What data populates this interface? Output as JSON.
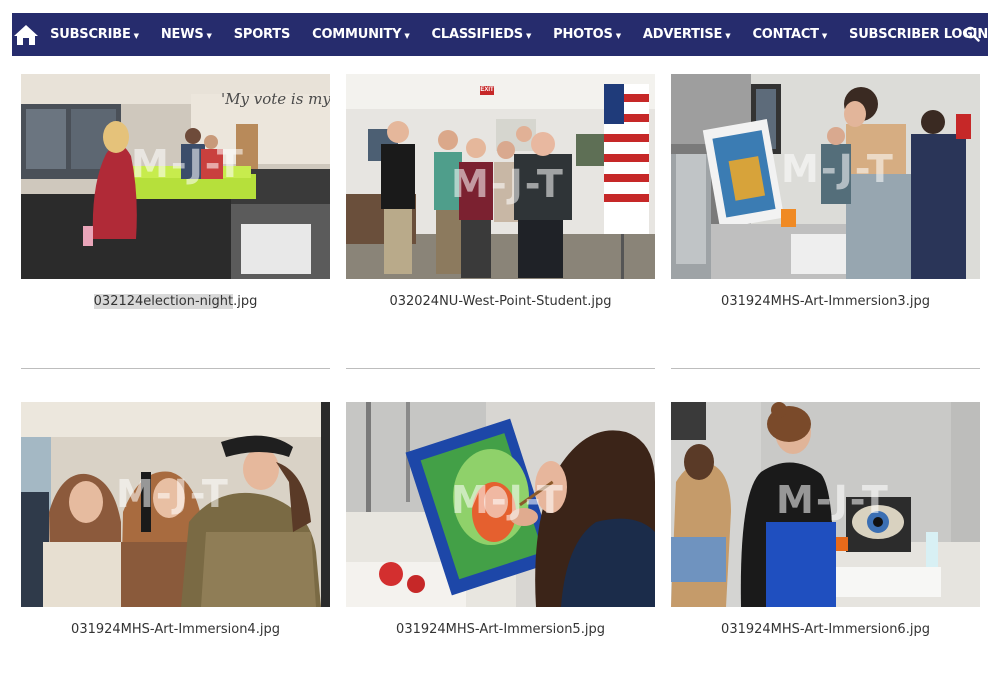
{
  "nav": {
    "home_icon": "home-icon",
    "items": [
      {
        "label": "SUBSCRIBE",
        "dropdown": true
      },
      {
        "label": "NEWS",
        "dropdown": true
      },
      {
        "label": "SPORTS",
        "dropdown": false
      },
      {
        "label": "COMMUNITY",
        "dropdown": true
      },
      {
        "label": "CLASSIFIEDS",
        "dropdown": true
      },
      {
        "label": "PHOTOS",
        "dropdown": true
      },
      {
        "label": "ADVERTISE",
        "dropdown": true
      },
      {
        "label": "CONTACT",
        "dropdown": true
      },
      {
        "label": "SUBSCRIBER LOGIN",
        "dropdown": false
      }
    ],
    "search_icon": "search-icon",
    "color": "#262c6d"
  },
  "gallery": {
    "watermark": "M-J-T",
    "photos": [
      {
        "caption": "032124election-night.jpg",
        "caption_highlight": "032124election-night",
        "caption_rest": ".jpg",
        "wall_text": "'My vote is my vo"
      },
      {
        "caption": "032024NU-West-Point-Student.jpg",
        "exit_sign": "EXIT"
      },
      {
        "caption": "031924MHS-Art-Immersion3.jpg"
      },
      {
        "caption": "031924MHS-Art-Immersion4.jpg"
      },
      {
        "caption": "031924MHS-Art-Immersion5.jpg"
      },
      {
        "caption": "031924MHS-Art-Immersion6.jpg"
      }
    ]
  }
}
